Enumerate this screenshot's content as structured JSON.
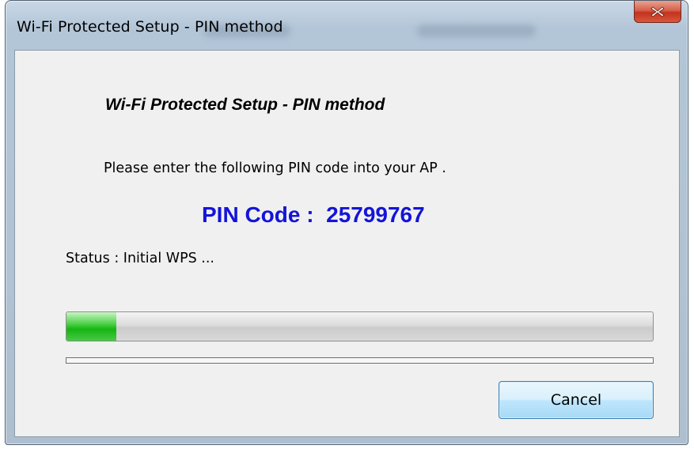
{
  "window": {
    "title": "Wi-Fi Protected Setup - PIN method",
    "close_icon": "close-x-icon"
  },
  "dialog": {
    "heading": "Wi-Fi Protected Setup - PIN method",
    "instruction": "Please enter the following PIN code into your AP .",
    "pin_label": "PIN Code :",
    "pin_value": "25799767",
    "status_text": "Status : Initial WPS ...",
    "progress_percent": 8.5,
    "cancel_label": "Cancel"
  },
  "colors": {
    "pin_text": "#1414d8",
    "progress_fill": "#14b512",
    "close_button": "#c2331d"
  }
}
